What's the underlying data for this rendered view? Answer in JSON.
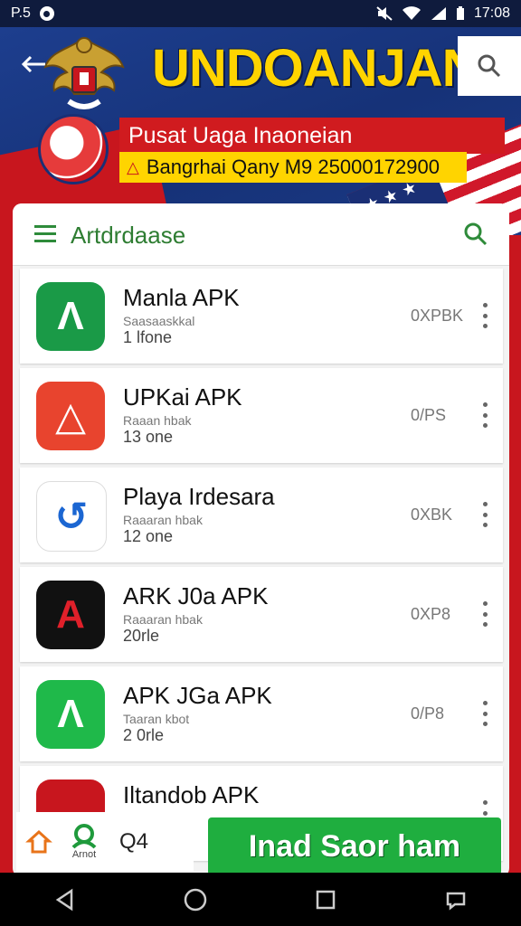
{
  "status_bar": {
    "left_text": "P.5",
    "time": "17:08"
  },
  "header": {
    "title": "UNDOANJAN",
    "banner_red": "Pusat Uaga Inaoneian",
    "banner_yellow": "Bangrhai Qany M9 25000172900"
  },
  "card": {
    "title": "Artdrdaase",
    "apps": [
      {
        "name": "Manla APK",
        "sub": "Saasaaskkal",
        "meta": "1 lfone",
        "size": "0XPBK",
        "icon": "letter-a-green",
        "glyph": "Λ",
        "bg": "#1a9a47"
      },
      {
        "name": "UPKai APK",
        "sub": "Raaan hbak",
        "meta": "13 one",
        "size": "0/PS",
        "icon": "triangle-multicolor",
        "glyph": "△",
        "bg": "#e8442e"
      },
      {
        "name": "Playa Irdesara",
        "sub": "Raaaran hbak",
        "meta": "12 one",
        "size": "0XBK",
        "icon": "circle-arrow-blue-green",
        "glyph": "↺",
        "bg": "#ffffff"
      },
      {
        "name": "ARK J0a APK",
        "sub": "Raaaran hbak",
        "meta": "20rle",
        "size": "0XP8",
        "icon": "letter-a-red-black",
        "glyph": "A",
        "bg": "#111111"
      },
      {
        "name": "APK JGa APK",
        "sub": "Taaran kbot",
        "meta": "2 0rle",
        "size": "0/P8",
        "icon": "letter-a-white-green",
        "glyph": "Λ",
        "bg": "#1fb94a"
      },
      {
        "name": "Iltandob APK",
        "sub": "",
        "meta": "",
        "size": "",
        "icon": "logo-red-black",
        "glyph": "",
        "bg": "#c8161e"
      }
    ]
  },
  "bottom": {
    "user_label": "Arnot",
    "count": "Q4",
    "cta_label": "Inad Saor ham"
  }
}
